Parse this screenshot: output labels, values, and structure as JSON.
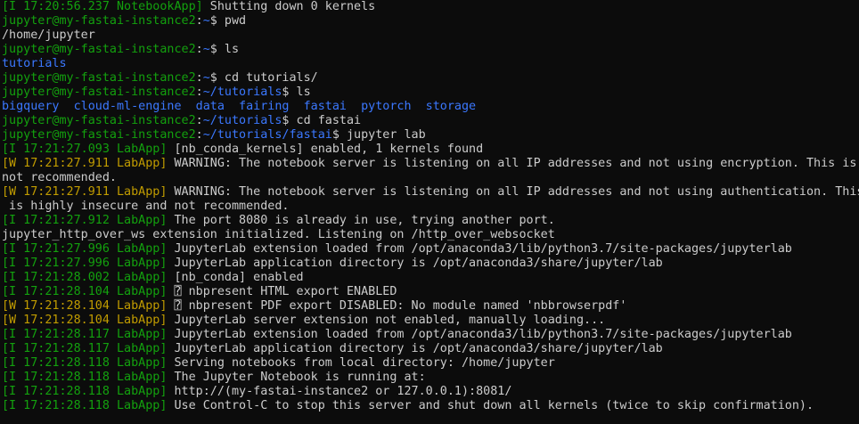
{
  "terminal": {
    "lines": [
      [
        {
          "t": "[I 17:20:56.237 NotebookApp]",
          "c": "logI"
        },
        {
          "t": " Shutting down 0 kernels",
          "c": "normal"
        }
      ],
      [
        {
          "t": "jupyter@my-fastai-instance2",
          "c": "user"
        },
        {
          "t": ":",
          "c": "normal"
        },
        {
          "t": "~",
          "c": "path"
        },
        {
          "t": "$ pwd",
          "c": "normal"
        }
      ],
      [
        {
          "t": "/home/jupyter",
          "c": "normal"
        }
      ],
      [
        {
          "t": "jupyter@my-fastai-instance2",
          "c": "user"
        },
        {
          "t": ":",
          "c": "normal"
        },
        {
          "t": "~",
          "c": "path"
        },
        {
          "t": "$ ls",
          "c": "normal"
        }
      ],
      [
        {
          "t": "tutorials",
          "c": "dir"
        }
      ],
      [
        {
          "t": "jupyter@my-fastai-instance2",
          "c": "user"
        },
        {
          "t": ":",
          "c": "normal"
        },
        {
          "t": "~",
          "c": "path"
        },
        {
          "t": "$ cd tutorials/",
          "c": "normal"
        }
      ],
      [
        {
          "t": "jupyter@my-fastai-instance2",
          "c": "user"
        },
        {
          "t": ":",
          "c": "normal"
        },
        {
          "t": "~/tutorials",
          "c": "path"
        },
        {
          "t": "$ ls",
          "c": "normal"
        }
      ],
      [
        {
          "t": "bigquery  cloud-ml-engine  data  fairing  fastai  pytorch  storage",
          "c": "dir"
        }
      ],
      [
        {
          "t": "jupyter@my-fastai-instance2",
          "c": "user"
        },
        {
          "t": ":",
          "c": "normal"
        },
        {
          "t": "~/tutorials",
          "c": "path"
        },
        {
          "t": "$ cd fastai",
          "c": "normal"
        }
      ],
      [
        {
          "t": "jupyter@my-fastai-instance2",
          "c": "user"
        },
        {
          "t": ":",
          "c": "normal"
        },
        {
          "t": "~/tutorials/fastai",
          "c": "path"
        },
        {
          "t": "$ jupyter lab",
          "c": "normal"
        }
      ],
      [
        {
          "t": "[I 17:21:27.093 LabApp]",
          "c": "logI"
        },
        {
          "t": " [nb_conda_kernels] enabled, 1 kernels found",
          "c": "normal"
        }
      ],
      [
        {
          "t": "[W 17:21:27.911 LabApp]",
          "c": "logW"
        },
        {
          "t": " WARNING: The notebook server is listening on all IP addresses and not using encryption. This is",
          "c": "normal"
        }
      ],
      [
        {
          "t": "not recommended.",
          "c": "normal"
        }
      ],
      [
        {
          "t": "[W 17:21:27.911 LabApp]",
          "c": "logW"
        },
        {
          "t": " WARNING: The notebook server is listening on all IP addresses and not using authentication. This",
          "c": "normal"
        }
      ],
      [
        {
          "t": " is highly insecure and not recommended.",
          "c": "normal"
        }
      ],
      [
        {
          "t": "[I 17:21:27.912 LabApp]",
          "c": "logI"
        },
        {
          "t": " The port 8080 is already in use, trying another port.",
          "c": "normal"
        }
      ],
      [
        {
          "t": "jupyter_http_over_ws extension initialized. Listening on /http_over_websocket",
          "c": "normal"
        }
      ],
      [
        {
          "t": "[I 17:21:27.996 LabApp]",
          "c": "logI"
        },
        {
          "t": " JupyterLab extension loaded from /opt/anaconda3/lib/python3.7/site-packages/jupyterlab",
          "c": "normal"
        }
      ],
      [
        {
          "t": "[I 17:21:27.996 LabApp]",
          "c": "logI"
        },
        {
          "t": " JupyterLab application directory is /opt/anaconda3/share/jupyter/lab",
          "c": "normal"
        }
      ],
      [
        {
          "t": "[I 17:21:28.002 LabApp]",
          "c": "logI"
        },
        {
          "t": " [nb_conda] enabled",
          "c": "normal"
        }
      ],
      [
        {
          "t": "[I 17:21:28.104 LabApp]",
          "c": "logI"
        },
        {
          "t": " ⍰ nbpresent HTML export ENABLED",
          "c": "normal"
        }
      ],
      [
        {
          "t": "[W 17:21:28.104 LabApp]",
          "c": "logW"
        },
        {
          "t": " ⍰ nbpresent PDF export DISABLED: No module named 'nbbrowserpdf'",
          "c": "normal"
        }
      ],
      [
        {
          "t": "[W 17:21:28.104 LabApp]",
          "c": "logW"
        },
        {
          "t": " JupyterLab server extension not enabled, manually loading...",
          "c": "normal"
        }
      ],
      [
        {
          "t": "[I 17:21:28.117 LabApp]",
          "c": "logI"
        },
        {
          "t": " JupyterLab extension loaded from /opt/anaconda3/lib/python3.7/site-packages/jupyterlab",
          "c": "normal"
        }
      ],
      [
        {
          "t": "[I 17:21:28.117 LabApp]",
          "c": "logI"
        },
        {
          "t": " JupyterLab application directory is /opt/anaconda3/share/jupyter/lab",
          "c": "normal"
        }
      ],
      [
        {
          "t": "[I 17:21:28.118 LabApp]",
          "c": "logI"
        },
        {
          "t": " Serving notebooks from local directory: /home/jupyter",
          "c": "normal"
        }
      ],
      [
        {
          "t": "[I 17:21:28.118 LabApp]",
          "c": "logI"
        },
        {
          "t": " The Jupyter Notebook is running at:",
          "c": "normal"
        }
      ],
      [
        {
          "t": "[I 17:21:28.118 LabApp]",
          "c": "logI"
        },
        {
          "t": " http://(my-fastai-instance2 or 127.0.0.1):8081/",
          "c": "normal"
        }
      ],
      [
        {
          "t": "[I 17:21:28.118 LabApp]",
          "c": "logI"
        },
        {
          "t": " Use Control-C to stop this server and shut down all kernels (twice to skip confirmation).",
          "c": "normal"
        }
      ]
    ],
    "colors": {
      "background": "#0c0c0c",
      "foreground": "#cccccc",
      "user": "#13a10e",
      "path": "#3b78ff",
      "info_tag": "#13a10e",
      "warn_tag": "#c19c00"
    }
  }
}
